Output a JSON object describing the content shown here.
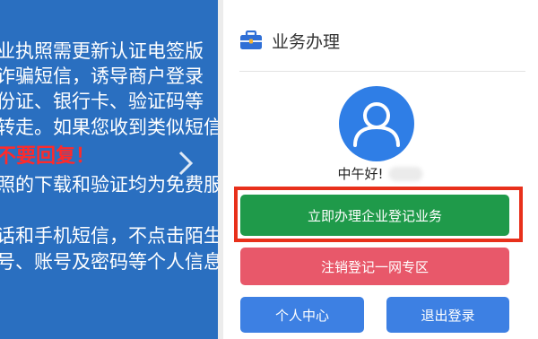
{
  "banner": {
    "lines": [
      "业执照需更新认证电签版",
      "诈骗短信，诱导商户登录",
      "份证、银行卡、验证码等",
      "转走。如果您收到类似短信",
      "不要回复！",
      "照的下载和验证均为免费服",
      "",
      "话和手机短信，不点击陌生",
      "号、账号及密码等个人信息"
    ],
    "warning_color": "#ff2a2a",
    "background_color": "#2a6fc0"
  },
  "panel": {
    "title": "业务办理",
    "icon": "briefcase-icon",
    "avatar_icon": "user-avatar-icon",
    "greeting": "中午好!",
    "highlight_color": "#e8301b"
  },
  "actions": {
    "primary_label": "立即办理企业登记业务",
    "cancel_label": "注销登记一网专区",
    "personal_label": "个人中心",
    "logout_label": "退出登录"
  },
  "colors": {
    "primary": "#1f9a4a",
    "cancel": "#e8586a",
    "secondary": "#3d80e3",
    "accent": "#3d80e3"
  }
}
